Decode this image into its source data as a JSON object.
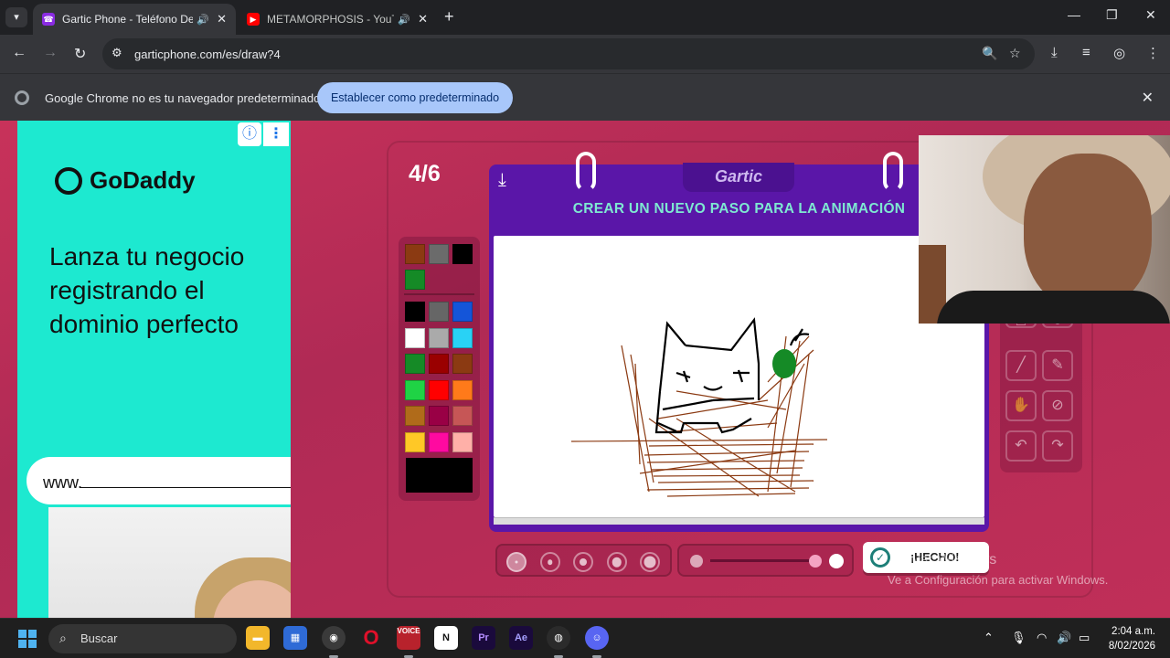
{
  "browser": {
    "tabs": [
      {
        "title": "Gartic Phone - Teléfono De",
        "active": true
      },
      {
        "title": "METAMORPHOSIS - YouTube",
        "active": false
      }
    ],
    "url": "garticphone.com/es/draw?4",
    "infobar": {
      "message": "Google Chrome no es tu navegador predeterminado",
      "button": "Establecer como predeterminado"
    }
  },
  "ad": {
    "brand": "GoDaddy",
    "headline": "Lanza tu negocio registrando el dominio perfecto",
    "field_text": "www."
  },
  "game": {
    "round": "4/6",
    "logo": "Gartic",
    "task": "CREAR UN NUEVO PASO PARA LA ANIMACIÓN",
    "done_label": "¡HECHO!",
    "palette_top": [
      "#8b3a12",
      "#6b6b6b",
      "#000000",
      "#158a26"
    ],
    "palette": [
      "#000000",
      "#666666",
      "#1455d9",
      "#ffffff",
      "#aaaaaa",
      "#29d2f5",
      "#158a26",
      "#9a0000",
      "#8b3a12",
      "#1fd345",
      "#ff0000",
      "#ff7a1a",
      "#b06b1a",
      "#990045",
      "#c65656",
      "#ffc826",
      "#ff0aa0",
      "#ffb0a8"
    ],
    "current_color": "#000000",
    "brush_sizes": [
      "size-1",
      "size-2",
      "size-3",
      "size-4",
      "size-5"
    ],
    "selected_brush": 0,
    "opacity": 1.0
  },
  "watermark": {
    "line1": "Activar Windows",
    "line2": "Ve a Configuración para activar Windows."
  },
  "taskbar": {
    "search_placeholder": "Buscar",
    "apps": [
      "file-explorer",
      "store",
      "chrome",
      "opera",
      "voicemeeter",
      "notion",
      "premiere-pro",
      "after-effects",
      "obs",
      "discord"
    ],
    "time": "2:04 a.m.",
    "date": "8/02/2026"
  }
}
